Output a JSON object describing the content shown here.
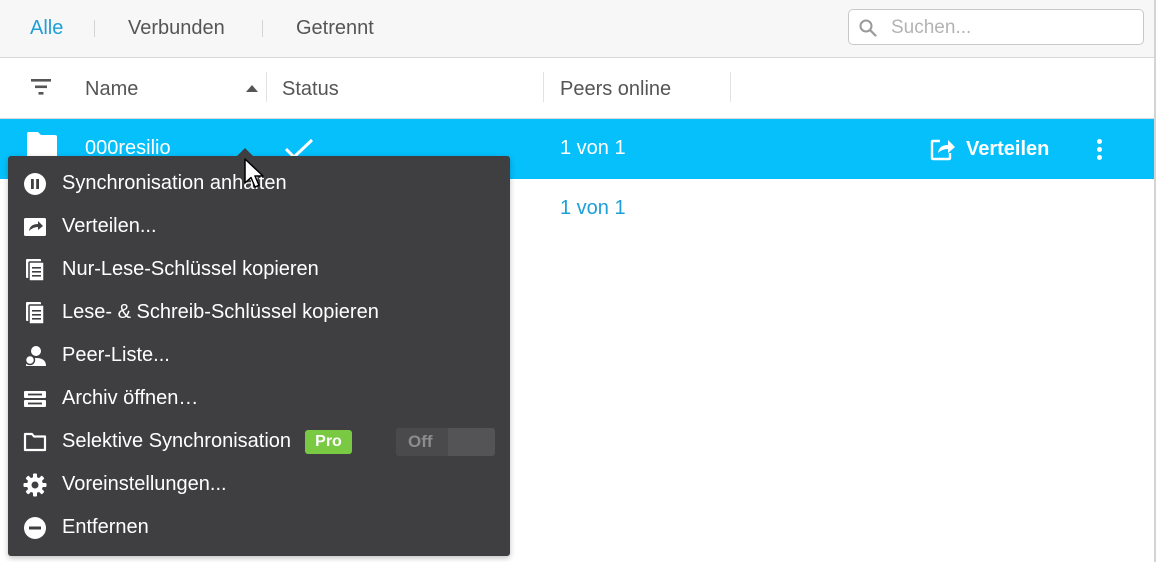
{
  "tabs": [
    {
      "label": "Alle",
      "active": true
    },
    {
      "label": "Verbunden",
      "active": false
    },
    {
      "label": "Getrennt",
      "active": false
    }
  ],
  "search": {
    "placeholder": "Suchen..."
  },
  "columns": {
    "name": "Name",
    "status": "Status",
    "peers": "Peers online"
  },
  "rows": [
    {
      "name": "000resilio",
      "status": "synced",
      "peers": "1 von 1",
      "selected": true,
      "share_label": "Verteilen"
    },
    {
      "name": "",
      "status": "",
      "peers": "1 von 1",
      "selected": false
    }
  ],
  "context_menu": {
    "items": [
      {
        "icon": "pause-circle-icon",
        "label": "Synchronisation anhalten"
      },
      {
        "icon": "share-arrow-icon",
        "label": "Verteilen..."
      },
      {
        "icon": "document-copy-icon",
        "label": "Nur-Lese-Schlüssel kopieren"
      },
      {
        "icon": "document-copy-icon",
        "label": "Lese- & Schreib-Schlüssel kopieren"
      },
      {
        "icon": "person-icon",
        "label": "Peer-Liste..."
      },
      {
        "icon": "archive-icon",
        "label": "Archiv öffnen…"
      },
      {
        "icon": "folder-outline-icon",
        "label": "Selektive Synchronisation"
      },
      {
        "icon": "gear-icon",
        "label": "Voreinstellungen..."
      },
      {
        "icon": "minus-circle-icon",
        "label": "Entfernen"
      }
    ],
    "pro_badge": "Pro",
    "toggle_state": "Off"
  },
  "colors": {
    "accent": "#1d9fd8",
    "selected_row": "#05c0fb",
    "menu_bg": "#3f3f41",
    "pro_badge": "#7ac943"
  }
}
